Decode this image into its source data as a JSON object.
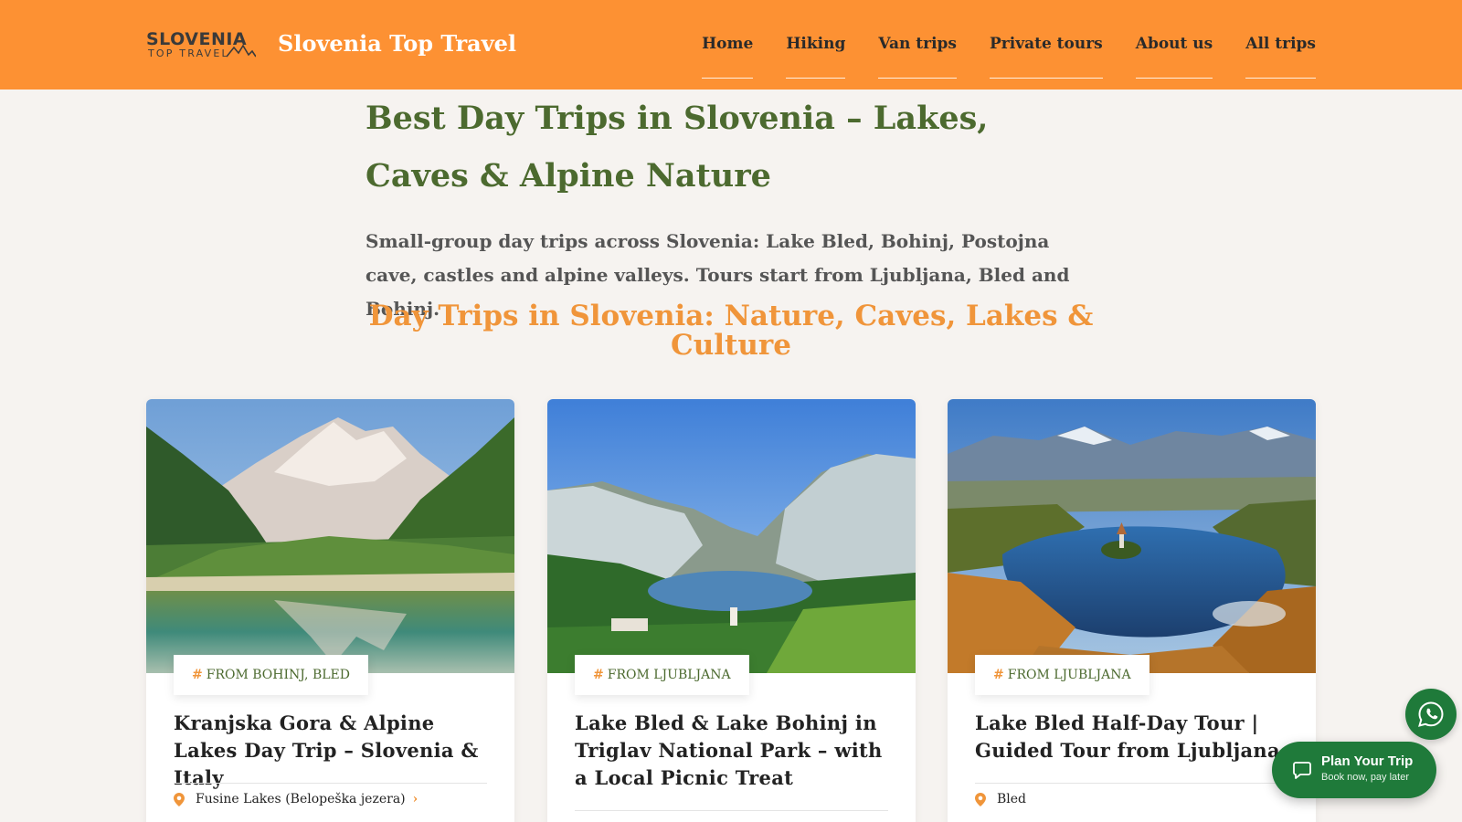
{
  "header": {
    "logo_main": "SLOVENIA",
    "logo_sub": "TOP TRAVEL",
    "site_title": "Slovenia Top Travel",
    "nav": [
      "Home",
      "Hiking",
      "Van trips",
      "Private tours",
      "About us",
      "All trips"
    ],
    "bg_color": "#fd9133"
  },
  "hero": {
    "title": "Best Day Trips in Slovenia – Lakes, Caves & Alpine Nature",
    "description": "Small-group day trips across Slovenia: Lake Bled, Bohinj, Postojna cave, castles and alpine valleys. Tours start from Ljubljana, Bled and Bohinj.",
    "section_title": "Day Trips in Slovenia: Nature, Caves, Lakes & Culture"
  },
  "cards": [
    {
      "tag": "FROM BOHINJ, BLED",
      "title": "Kranjska Gora & Alpine Lakes Day Trip – Slovenia & Italy",
      "location": "Fusine Lakes (Belopeška jezera)",
      "has_more": true,
      "image_icon": "mountain-lake-image"
    },
    {
      "tag": "FROM LJUBLJANA",
      "title": "Lake Bled & Lake Bohinj in Triglav National Park – with a Local Picnic Treat",
      "location": "",
      "has_more": false,
      "image_icon": "valley-lake-image"
    },
    {
      "tag": "FROM LJUBLJANA",
      "title": "Lake Bled Half-Day Tour | Guided Tour from Ljubljana",
      "location": "Bled",
      "has_more": false,
      "image_icon": "lake-bled-island-image"
    }
  ],
  "floating": {
    "whatsapp_icon": "whatsapp-icon",
    "plan_title": "Plan Your Trip",
    "plan_sub": "Book now, pay later",
    "accent_color": "#1f7a3a"
  },
  "colors": {
    "title_green": "#4c6a2f",
    "accent_orange": "#f0953a",
    "page_bg": "#f6f3f0"
  }
}
